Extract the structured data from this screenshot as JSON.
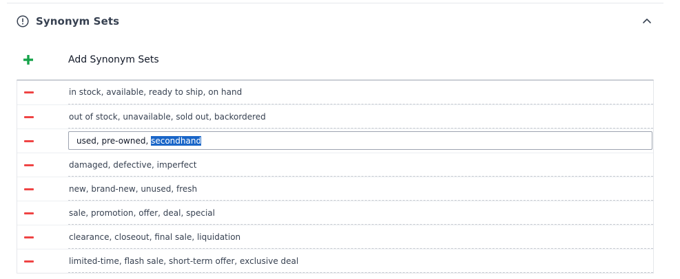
{
  "section": {
    "title": "Synonym Sets",
    "info_icon": "info-circle-icon",
    "collapse_icon": "chevron-up-icon"
  },
  "add": {
    "icon": "plus-icon",
    "label": "Add Synonym Sets",
    "color": "#16a34a"
  },
  "remove_color": "#ef4444",
  "synonym_sets": [
    {
      "text": "in stock, available, ready to ship, on hand"
    },
    {
      "text": "out of stock, unavailable, sold out, backordered"
    },
    {
      "text": "used, pre-owned, secondhand",
      "editing": true,
      "text_before_selection": "used, pre-owned, ",
      "selected_text": "secondhand"
    },
    {
      "text": "damaged, defective, imperfect"
    },
    {
      "text": "new, brand-new, unused, fresh"
    },
    {
      "text": "sale, promotion, offer, deal, special"
    },
    {
      "text": "clearance, closeout, final sale, liquidation"
    },
    {
      "text": "limited-time, flash sale, short-term offer, exclusive deal"
    }
  ]
}
